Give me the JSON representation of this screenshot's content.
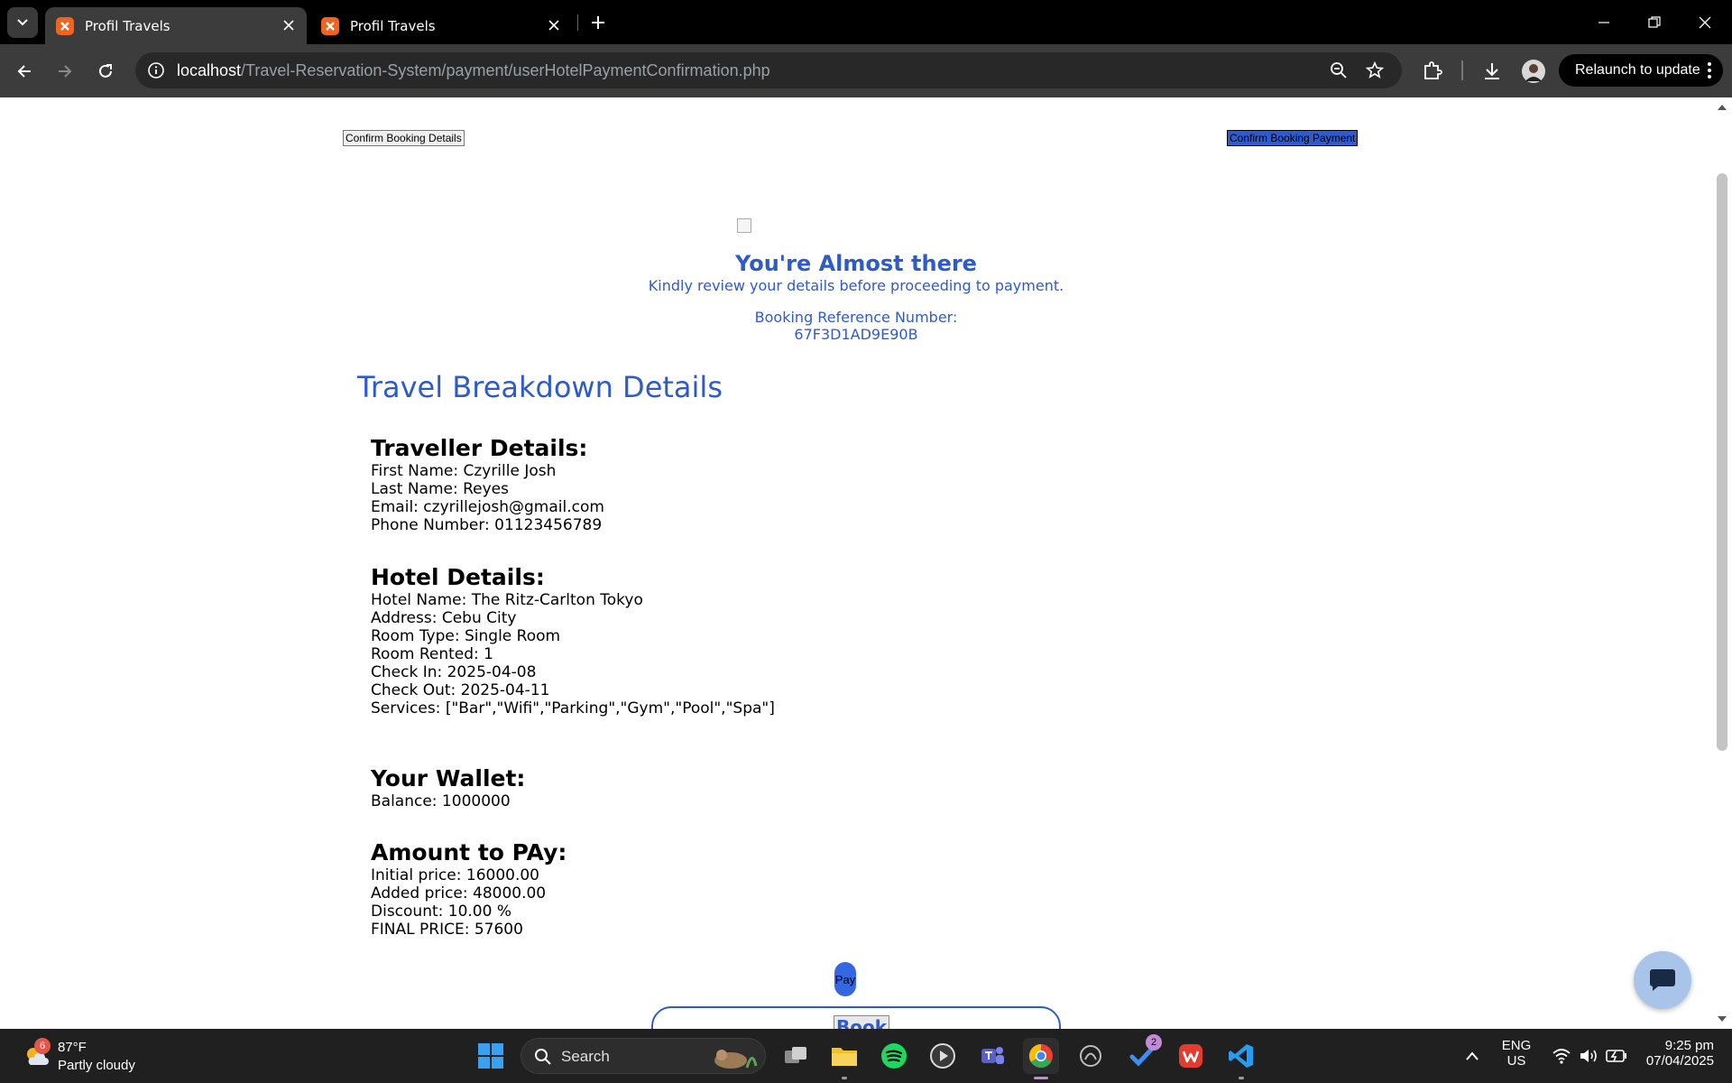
{
  "browser": {
    "tabs": [
      {
        "title": "Profil Travels",
        "active": true
      },
      {
        "title": "Profil Travels",
        "active": false
      }
    ],
    "url_host": "localhost",
    "url_path": "/Travel-Reservation-System/payment/userHotelPaymentConfirmation.php",
    "relaunch_label": "Relaunch to update"
  },
  "page": {
    "steps": {
      "details": "Confirm Booking Details",
      "payment": "Confirm Booking Payment"
    },
    "hero": {
      "title": "You're Almost there",
      "subtitle": "Kindly review your details before proceeding to payment.",
      "ref_label": "Booking Reference Number:",
      "ref_number": "67F3D1AD9E90B"
    },
    "section_title": "Travel Breakdown Details",
    "traveller": {
      "heading": "Traveller Details:",
      "first_name": "First Name: Czyrille Josh",
      "last_name": "Last Name: Reyes",
      "email": "Email: czyrillejosh@gmail.com",
      "phone": "Phone Number: 01123456789"
    },
    "hotel": {
      "heading": "Hotel Details:",
      "name": "Hotel Name: The Ritz-Carlton Tokyo",
      "address": "Address: Cebu City",
      "room_type": "Room Type: Single Room",
      "rooms": "Room Rented: 1",
      "check_in": "Check In: 2025-04-08",
      "check_out": "Check Out: 2025-04-11",
      "services": "Services: [\"Bar\",\"Wifi\",\"Parking\",\"Gym\",\"Pool\",\"Spa\"]"
    },
    "wallet": {
      "heading": "Your Wallet:",
      "balance": "Balance: 1000000"
    },
    "amount": {
      "heading": "Amount to PAy:",
      "initial": "Initial price: 16000.00",
      "added": "Added price: 48000.00",
      "discount": "Discount: 10.00 %",
      "final": "FINAL PRICE: 57600"
    },
    "pay_label": "Pay",
    "book_label": "Book"
  },
  "taskbar": {
    "weather_badge": "6",
    "temperature": "87°F",
    "condition": "Partly cloudy",
    "search_label": "Search",
    "todo_badge": "2",
    "lang_line1": "ENG",
    "lang_line2": "US",
    "time": "9:25 pm",
    "date": "07/04/2025"
  },
  "colors": {
    "accent_blue": "#2f5bc9",
    "pay_button": "#3567e2",
    "current_step": "#2f5bd1"
  }
}
